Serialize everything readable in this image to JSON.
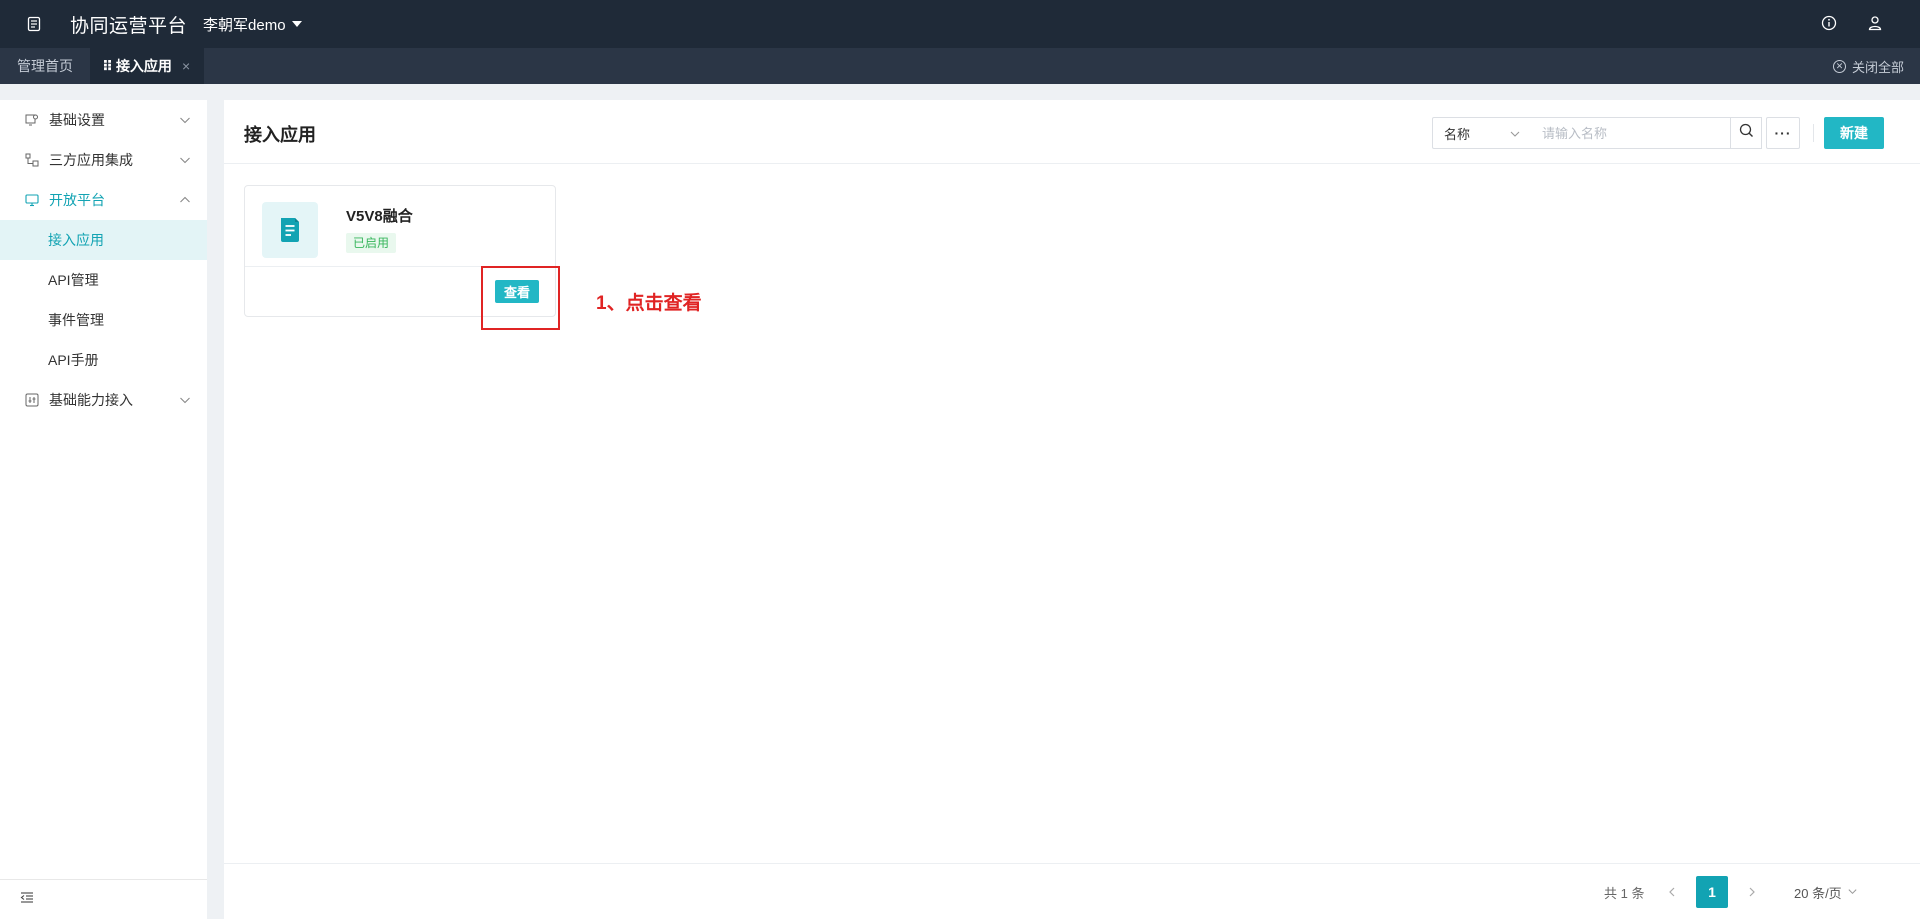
{
  "topbar": {
    "app_title": "协同运营平台",
    "user_name": "李朝军demo",
    "icons": [
      "doc-icon",
      "info-icon",
      "user-icon"
    ]
  },
  "tabs": {
    "items": [
      {
        "label": "管理首页",
        "active": false
      },
      {
        "label": "接入应用",
        "active": true
      }
    ],
    "drag_handle": "⠿",
    "close_glyph": "×",
    "close_all_label": "关闭全部"
  },
  "sidebar": {
    "groups": [
      {
        "label": "基础设置",
        "icon": "settings-icon",
        "expanded": false
      },
      {
        "label": "三方应用集成",
        "icon": "integration-icon",
        "expanded": false
      },
      {
        "label": "开放平台",
        "icon": "monitor-icon",
        "expanded": true,
        "children": [
          {
            "label": "接入应用",
            "active": true
          },
          {
            "label": "API管理",
            "active": false
          },
          {
            "label": "事件管理",
            "active": false
          },
          {
            "label": "API手册",
            "active": false
          }
        ]
      },
      {
        "label": "基础能力接入",
        "icon": "capability-icon",
        "expanded": false
      }
    ]
  },
  "main": {
    "title": "接入应用",
    "filter": {
      "selected": "名称"
    },
    "search": {
      "placeholder": "请输入名称"
    },
    "more_label": "···",
    "new_label": "新建",
    "cards": [
      {
        "name": "V5V8融合",
        "status": "已启用",
        "view_label": "查看"
      }
    ],
    "annotation": "1、点击查看"
  },
  "pagination": {
    "total_text": "共 1 条",
    "current_page": "1",
    "page_size_text": "20 条/页"
  },
  "colors": {
    "topbar_bg": "#1f2a38",
    "accent": "#12a3b3",
    "button": "#22b7c5",
    "status_green": "#38b65c",
    "annotation_red": "#e02424"
  }
}
